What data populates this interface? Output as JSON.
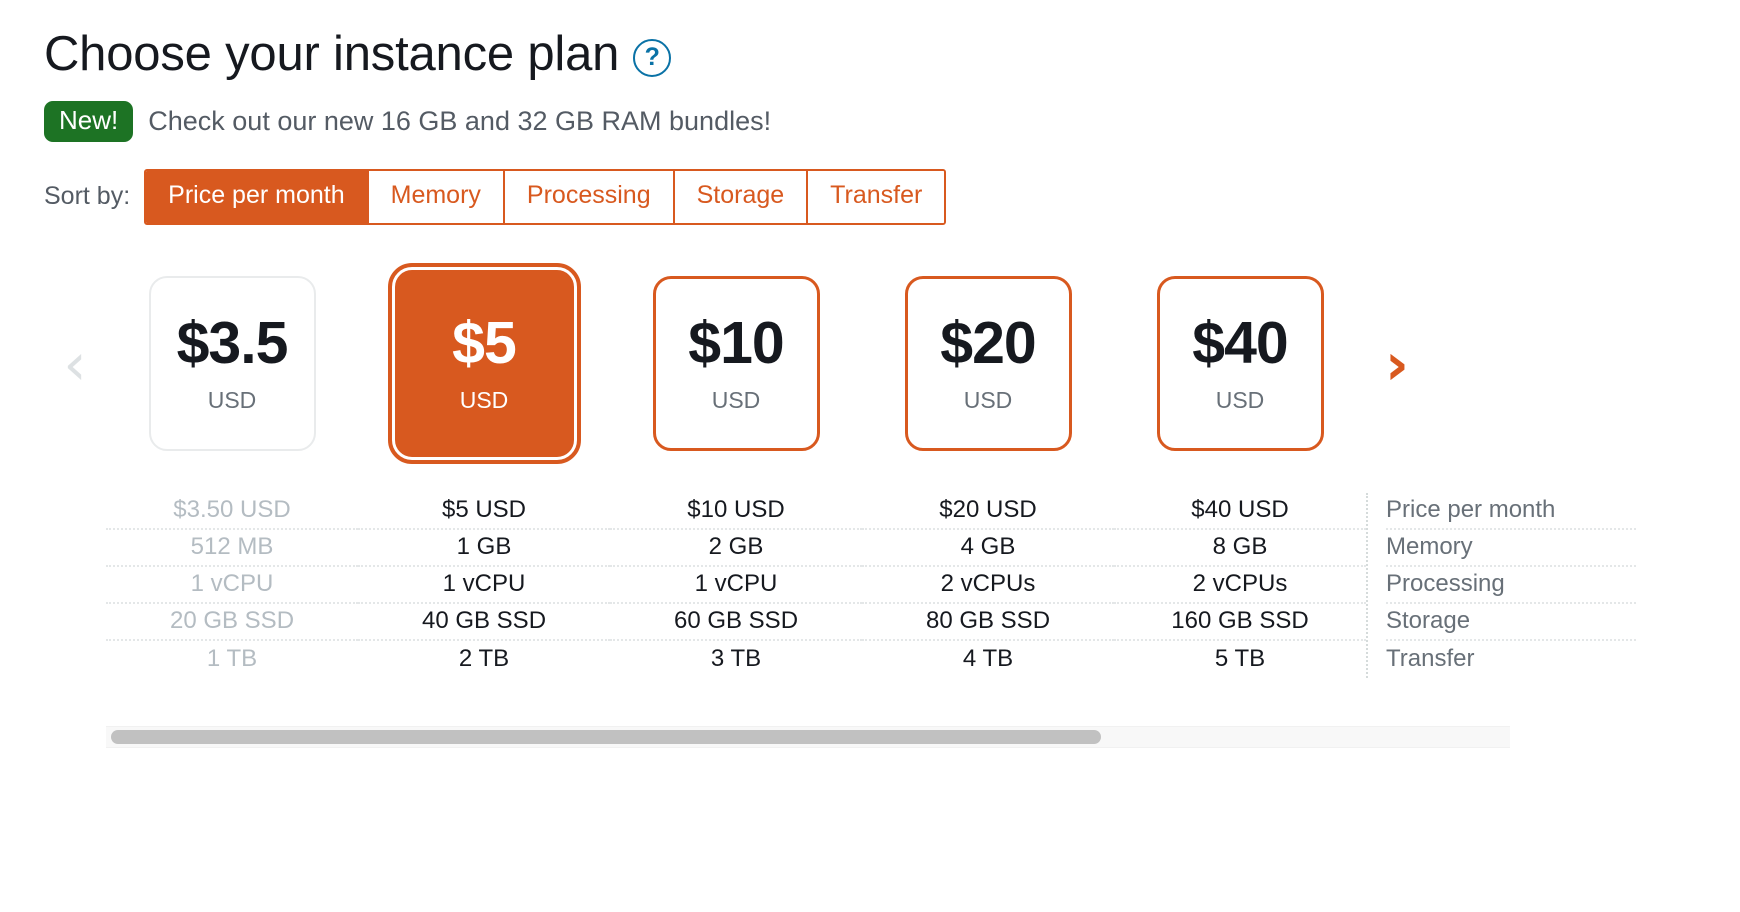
{
  "header": {
    "title": "Choose your instance plan",
    "help_icon": "question-mark-circle-icon",
    "help_glyph": "?"
  },
  "banner": {
    "badge": "New!",
    "message": "Check out our new 16 GB and 32 GB RAM bundles!",
    "badge_color": "#1d7324"
  },
  "sort": {
    "label": "Sort by:",
    "options": [
      {
        "label": "Price per month",
        "active": true
      },
      {
        "label": "Memory",
        "active": false
      },
      {
        "label": "Processing",
        "active": false
      },
      {
        "label": "Storage",
        "active": false
      },
      {
        "label": "Transfer",
        "active": false
      }
    ],
    "accent_color": "#d8591f"
  },
  "carousel": {
    "prev_icon": "chevron-left-icon",
    "prev_glyph": "‹",
    "prev_enabled": false,
    "next_icon": "chevron-right-icon",
    "next_glyph": "›",
    "next_enabled": true
  },
  "plans": [
    {
      "price": "$3.5",
      "currency": "USD",
      "state": "disabled"
    },
    {
      "price": "$5",
      "currency": "USD",
      "state": "selected"
    },
    {
      "price": "$10",
      "currency": "USD",
      "state": "available"
    },
    {
      "price": "$20",
      "currency": "USD",
      "state": "available"
    },
    {
      "price": "$40",
      "currency": "USD",
      "state": "available"
    }
  ],
  "spec_table": {
    "row_labels": [
      "Price per month",
      "Memory",
      "Processing",
      "Storage",
      "Transfer"
    ],
    "columns": [
      {
        "disabled": true,
        "values": [
          "$3.50 USD",
          "512 MB",
          "1 vCPU",
          "20 GB SSD",
          "1 TB"
        ]
      },
      {
        "disabled": false,
        "values": [
          "$5 USD",
          "1 GB",
          "1 vCPU",
          "40 GB SSD",
          "2 TB"
        ]
      },
      {
        "disabled": false,
        "values": [
          "$10 USD",
          "2 GB",
          "1 vCPU",
          "60 GB SSD",
          "3 TB"
        ]
      },
      {
        "disabled": false,
        "values": [
          "$20 USD",
          "4 GB",
          "2 vCPUs",
          "80 GB SSD",
          "4 TB"
        ]
      },
      {
        "disabled": false,
        "values": [
          "$40 USD",
          "8 GB",
          "2 vCPUs",
          "160 GB SSD",
          "5 TB"
        ]
      }
    ]
  },
  "scrollbar": {
    "orientation": "horizontal",
    "thumb_percent": 71
  }
}
